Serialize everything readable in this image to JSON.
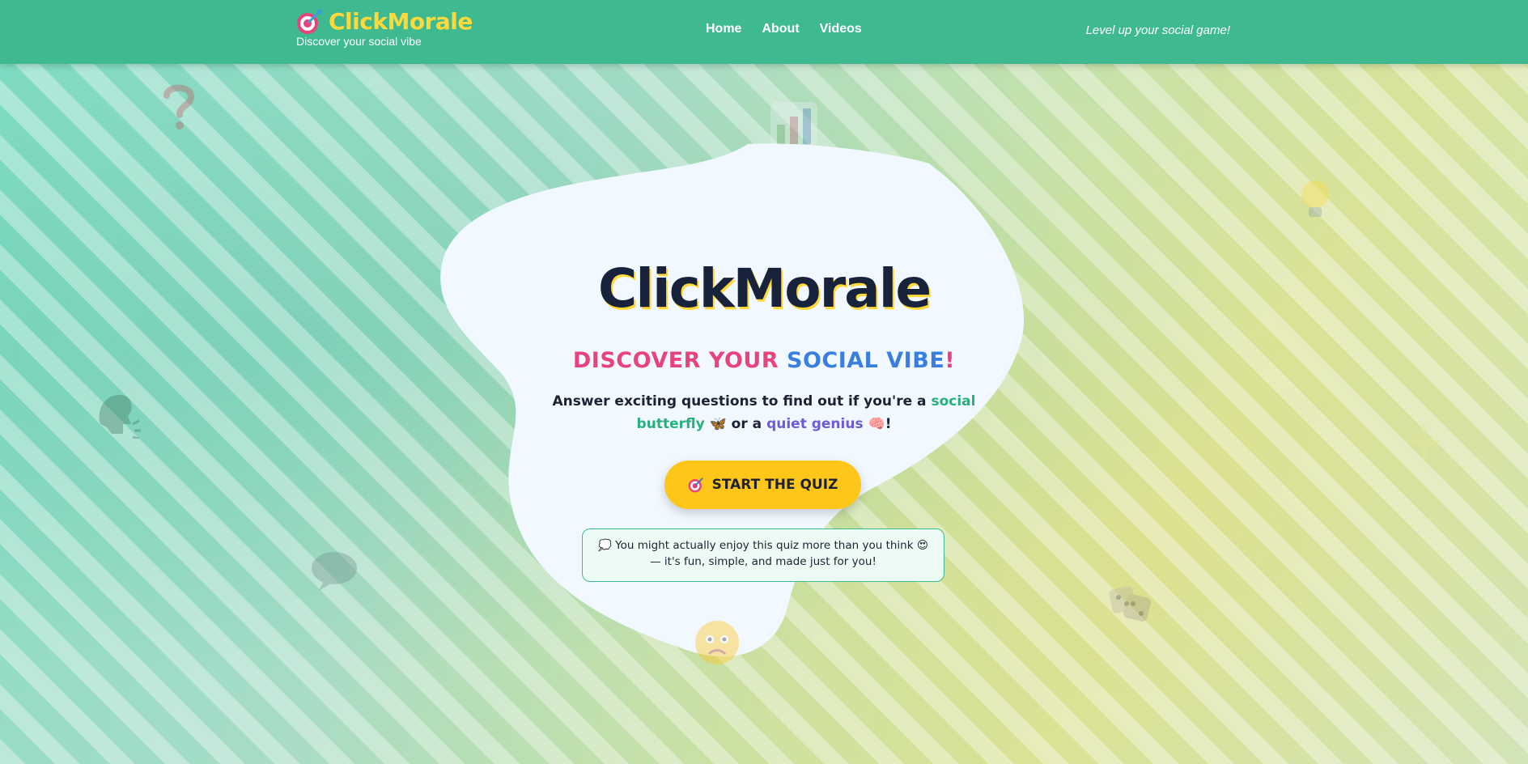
{
  "header": {
    "brand_name": "ClickMorale",
    "brand_sub": "Discover your social vibe",
    "nav": [
      {
        "label": "Home"
      },
      {
        "label": "About"
      },
      {
        "label": "Videos"
      }
    ],
    "tagline": "Level up your social game!"
  },
  "hero": {
    "title": "ClickMorale",
    "subtitle_part1": "DISCOVER YOUR ",
    "subtitle_part2": "SOCIAL VIBE",
    "subtitle_part3": "!",
    "desc_part1": "Answer exciting questions to find out if you're a ",
    "desc_highlight1": "social butterfly",
    "desc_emoji1": "🦋",
    "desc_part2": " or a ",
    "desc_highlight2": "quiet genius",
    "desc_emoji2": "🧠",
    "desc_part3": "!",
    "cta_label": "START THE QUIZ",
    "note_icon": "💭",
    "note_text_1": "You might actually enjoy this quiz more than you think",
    "note_emoji": "😍",
    "note_text_2": "— it's fun, simple, and made just for you!"
  },
  "colors": {
    "header_bg": "#3fba90",
    "brand_yellow": "#ffd83a",
    "cta_yellow": "#ffc61a",
    "pink": "#e8437c",
    "blue": "#3a7fe0",
    "green_highlight": "#27b07c",
    "purple_highlight": "#6b5bd8"
  },
  "icons": {
    "logo": "target-dart-icon",
    "cta": "target-dart-icon",
    "floating": [
      "question-mark-icon",
      "bar-chart-icon",
      "lightbulb-icon",
      "target-dart-icon",
      "speaking-head-icon",
      "speech-bubble-icon",
      "confused-face-icon",
      "dice-icon",
      "sparkle-icon"
    ]
  }
}
